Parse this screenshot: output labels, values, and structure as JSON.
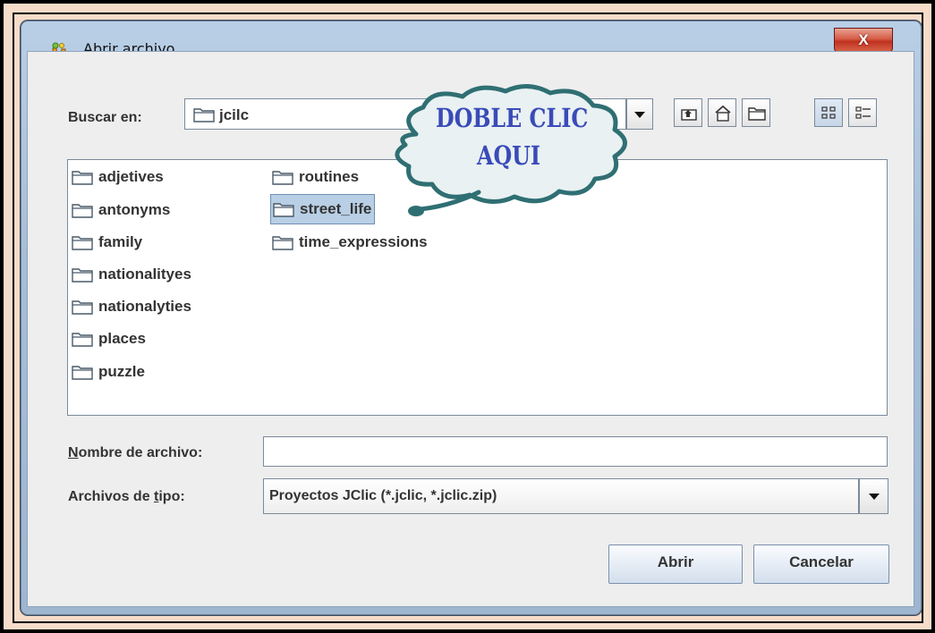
{
  "window": {
    "title": "Abrir archivo",
    "close_label": "X"
  },
  "look_in": {
    "label": "Buscar en:",
    "value": "jcilc"
  },
  "toolbar": {
    "icons": [
      "up-folder-icon",
      "home-icon",
      "new-folder-icon",
      "list-view-icon",
      "details-view-icon"
    ]
  },
  "folders_col1": [
    "adjetives",
    "antonyms",
    "family",
    "nationalityes",
    "nationalyties",
    "places",
    "puzzle"
  ],
  "folders_col2": [
    "routines",
    "street_life",
    "time_expressions"
  ],
  "selected_folder": "street_life",
  "file_name": {
    "label_mnemonic": "N",
    "label_rest": "ombre de archivo:",
    "value": ""
  },
  "file_type": {
    "label_pre": "Archivos de ",
    "label_mnemonic": "t",
    "label_post": "ipo:",
    "value": "Proyectos JClic (*.jclic, *.jclic.zip)"
  },
  "buttons": {
    "open": "Abrir",
    "cancel": "Cancelar"
  },
  "callout": {
    "line1": "DOBLE CLIC",
    "line2": "AQUI",
    "color": "#2f6f73"
  }
}
